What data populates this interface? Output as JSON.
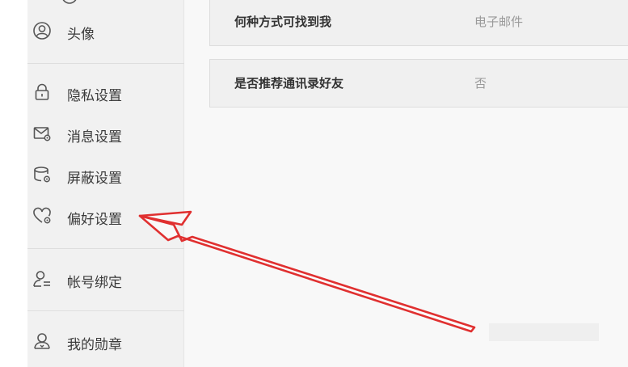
{
  "sidebar": {
    "items": [
      {
        "label": "头像",
        "icon": "avatar-icon"
      },
      {
        "label": "隐私设置",
        "icon": "lock-icon"
      },
      {
        "label": "消息设置",
        "icon": "message-settings-icon"
      },
      {
        "label": "屏蔽设置",
        "icon": "block-settings-icon"
      },
      {
        "label": "偏好设置",
        "icon": "heart-gear-icon"
      },
      {
        "label": "帐号绑定",
        "icon": "account-bind-icon"
      },
      {
        "label": "我的勋章",
        "icon": "medal-icon"
      }
    ]
  },
  "main": {
    "rows": [
      {
        "label": "何种方式可找到我",
        "value": "电子邮件"
      },
      {
        "label": "是否推荐通讯录好友",
        "value": "否"
      }
    ]
  },
  "annotation": {
    "arrow_color": "#e03030"
  }
}
